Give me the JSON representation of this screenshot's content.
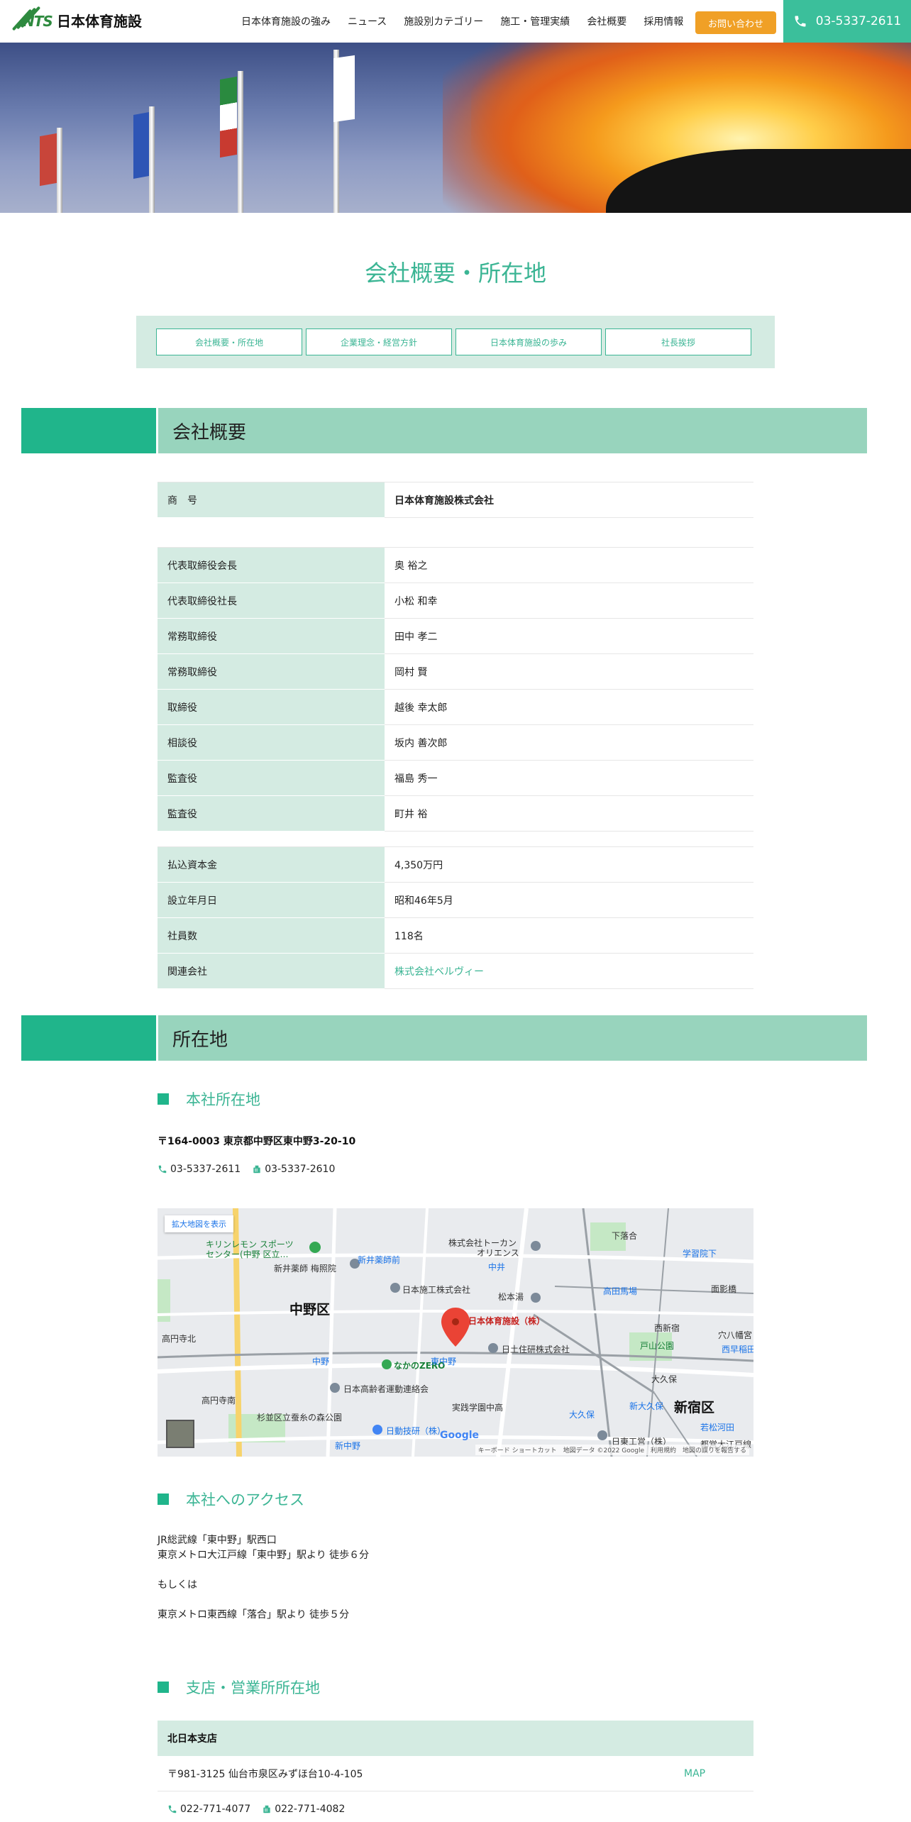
{
  "header": {
    "logo_abbr": "NTS",
    "logo_name": "日本体育施設",
    "nav": [
      "日本体育施設の強み",
      "ニュース",
      "施設別カテゴリー",
      "施工・管理実績",
      "会社概要",
      "採用情報"
    ],
    "contact_button": "お問い合わせ",
    "phone": "03-5337-2611",
    "accent_color": "#3bbf9b",
    "cta_color": "#f0a026"
  },
  "page": {
    "title": "会社概要・所在地"
  },
  "subnav": [
    "会社概要・所在地",
    "企業理念・経営方針",
    "日本体育施設の歩み",
    "社長挨拶"
  ],
  "overview": {
    "heading": "会社概要",
    "trade_name_label": "商　号",
    "trade_name": "日本体育施設株式会社",
    "officers": [
      {
        "title": "代表取締役会長",
        "name": "奥 裕之"
      },
      {
        "title": "代表取締役社長",
        "name": "小松 和幸"
      },
      {
        "title": "常務取締役",
        "name": "田中 孝二"
      },
      {
        "title": "常務取締役",
        "name": "岡村 賢"
      },
      {
        "title": "取締役",
        "name": "越後 幸太郎"
      },
      {
        "title": "相談役",
        "name": "坂内 善次郎"
      },
      {
        "title": "監査役",
        "name": "福島 秀一"
      },
      {
        "title": "監査役",
        "name": "町井 裕"
      }
    ],
    "facts": [
      {
        "label": "払込資本金",
        "value": "4,350万円"
      },
      {
        "label": "設立年月日",
        "value": "昭和46年5月"
      },
      {
        "label": "社員数",
        "value": "118名"
      }
    ],
    "related_label": "関連会社",
    "related_value": "株式会社ベルヴィー"
  },
  "location": {
    "heading": "所在地",
    "hq_heading": "本社所在地",
    "hq_address": "〒164-0003 東京都中野区東中野3-20-10",
    "hq_tel": "03-5337-2611",
    "hq_fax": "03-5337-2610",
    "map": {
      "enlarge": "拡大地図を表示",
      "marker": "日本体育施設（株）",
      "labels": [
        "中野区",
        "新宿区",
        "キリンレモン スポーツ",
        "センター(中野 区立…",
        "新井薬師 梅照院",
        "日本施工株式会社",
        "株式会社トーカン",
        "オリエンス",
        "日土住研株式会社",
        "なかのZERO",
        "日本高齢者運動連絡会",
        "日動技研（株）",
        "実践学園中高",
        "日東工営（株）",
        "高円寺北",
        "高円寺南",
        "戸山公園",
        "大久保",
        "新大久保",
        "穴八幡宮",
        "西早稲田",
        "学習院下",
        "面影橋",
        "下落合",
        "高田馬場",
        "中野",
        "東中野",
        "新井薬師前",
        "中井",
        "松本湯",
        "大久保",
        "杉並区立蚕糸の森公園",
        "新中野",
        "若松河田",
        "都営大江戸線",
        "西新宿"
      ],
      "footer": "キーボード ショートカット　地図データ ©2022 Google　利用規約　地図の誤りを報告する",
      "google": "Google"
    },
    "access_heading": "本社へのアクセス",
    "access_line1": "JR総武線「東中野」駅西口",
    "access_line2": "東京メトロ大江戸線「東中野」駅より 徒歩６分",
    "access_or": "もしくは",
    "access_line3": "東京メトロ東西線「落合」駅より 徒歩５分",
    "branch_heading": "支店・営業所所在地",
    "branch": {
      "name": "北日本支店",
      "address": "〒981-3125 仙台市泉区みずほ台10-4-105",
      "map_link": "MAP",
      "tel": "022-771-4077",
      "fax": "022-771-4082"
    }
  }
}
